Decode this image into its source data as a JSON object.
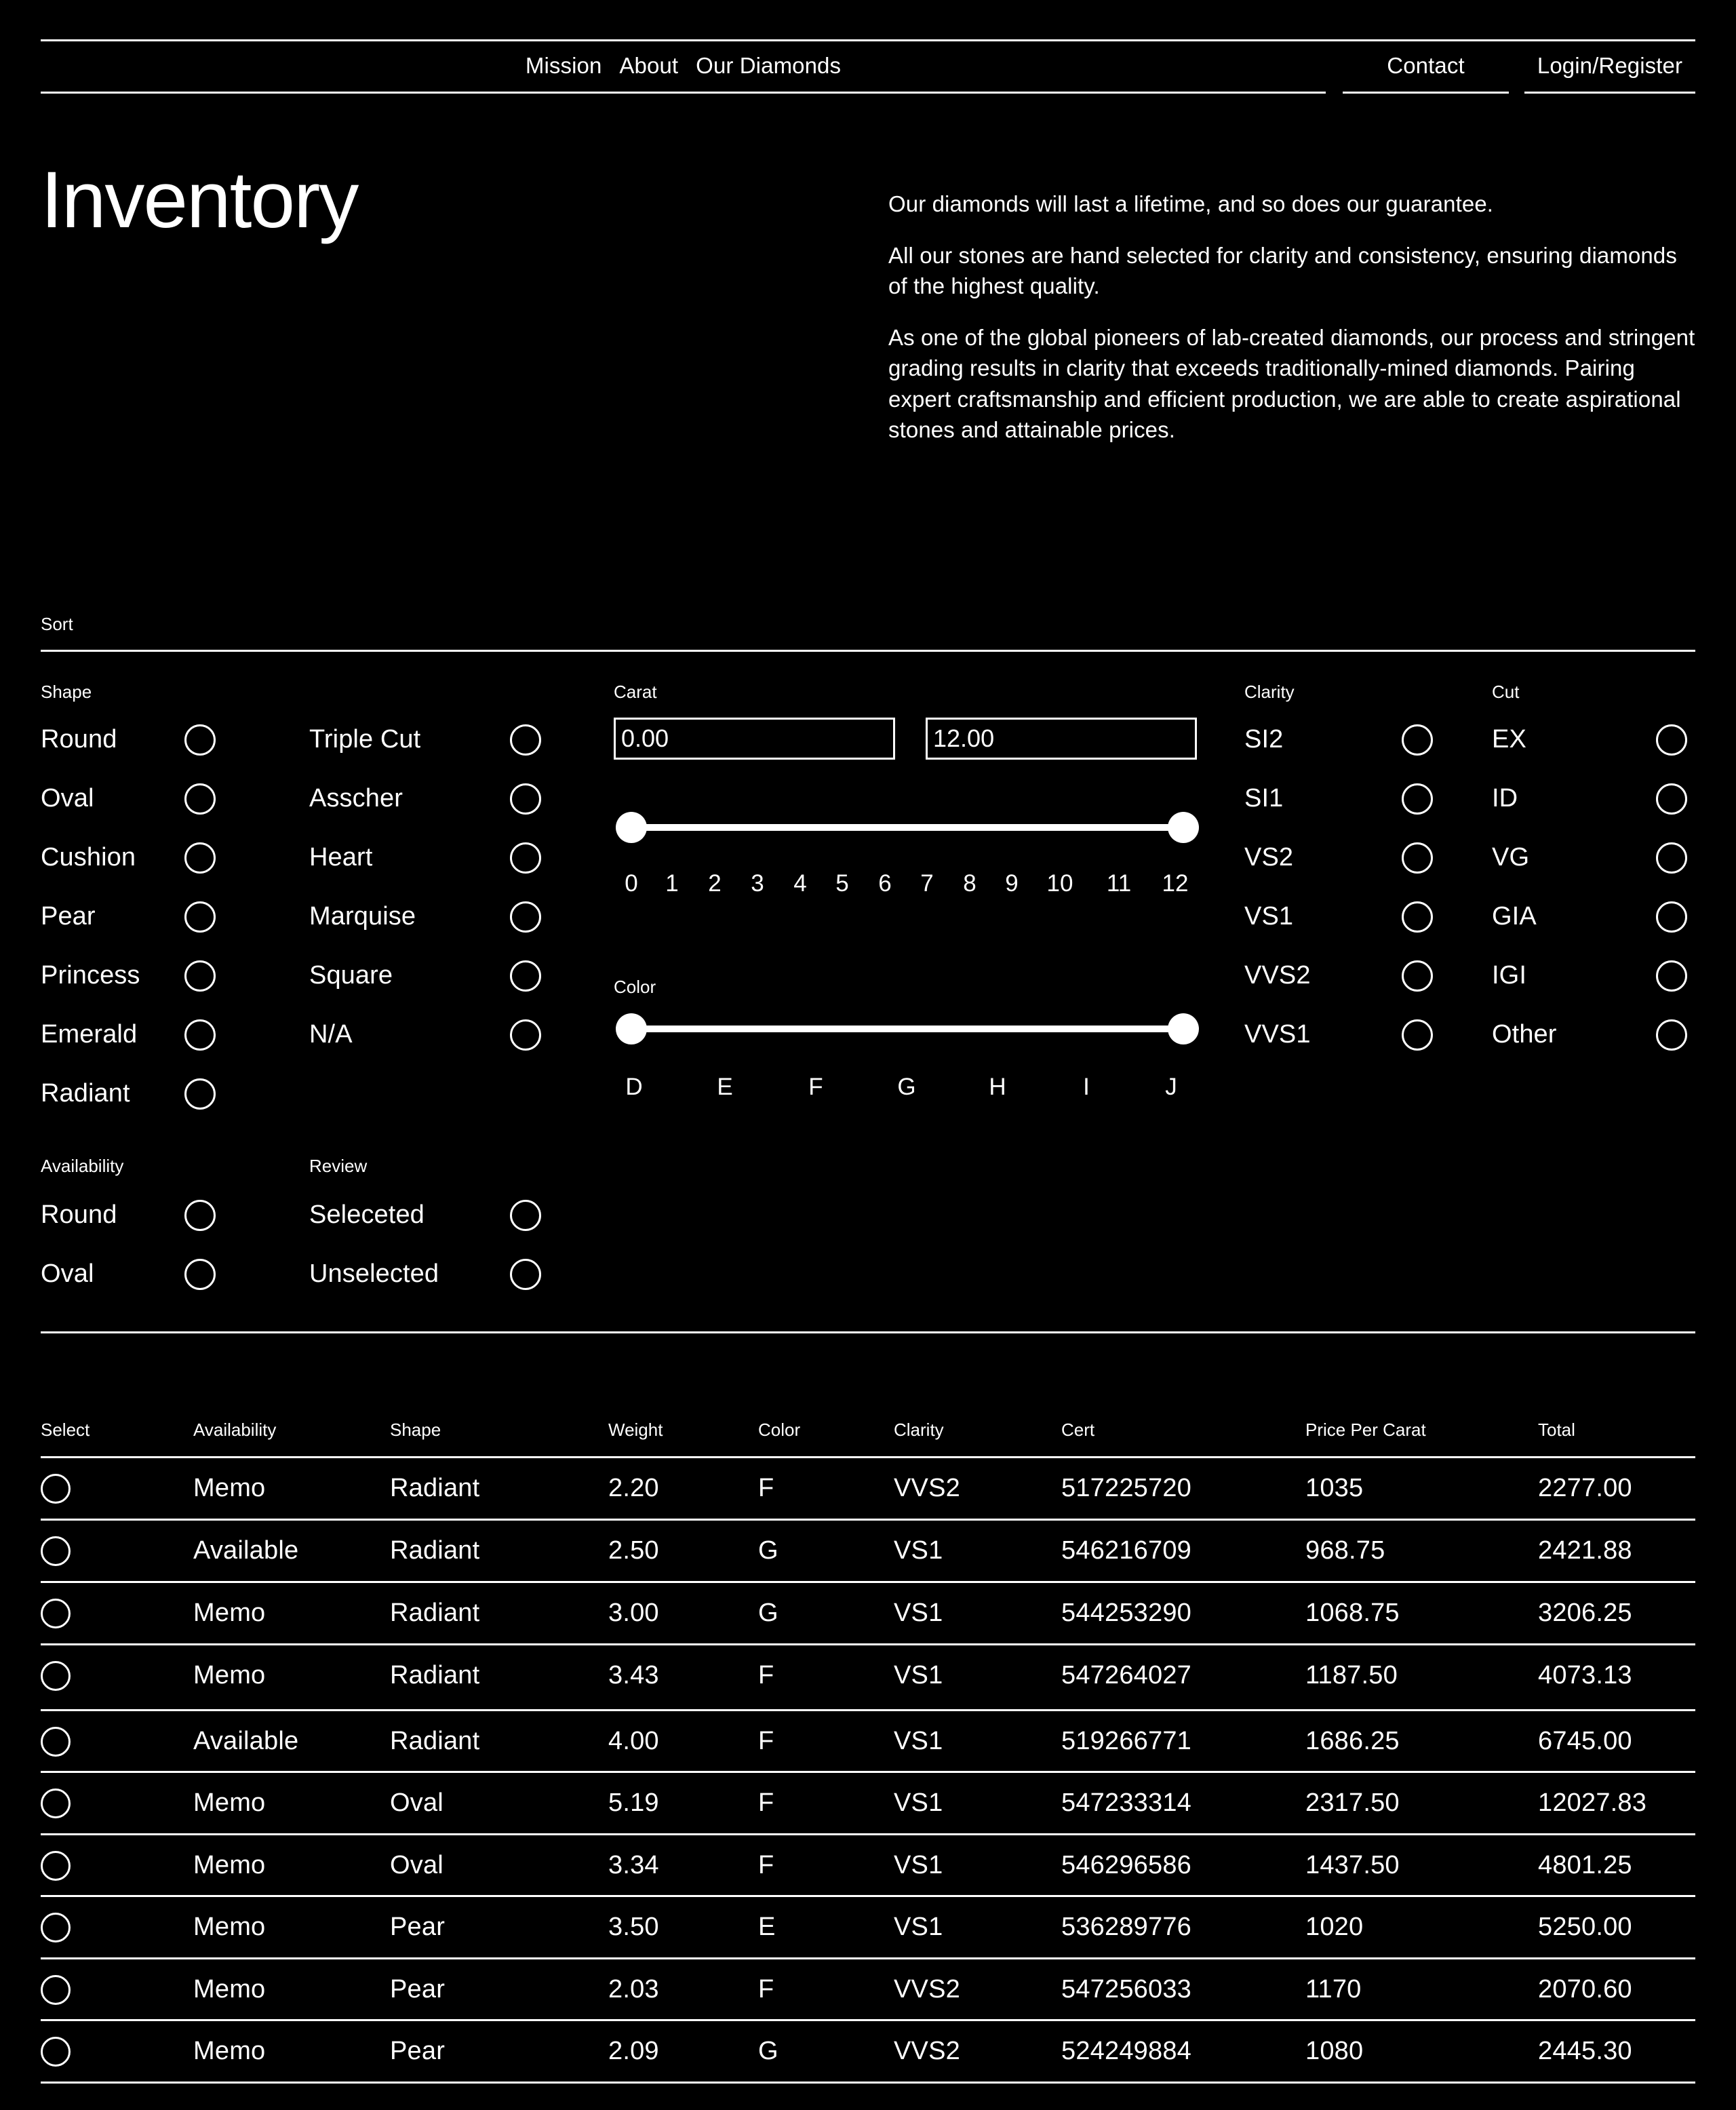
{
  "nav": {
    "primary": [
      "Mission",
      "About",
      "Our Diamonds"
    ],
    "contact": "Contact",
    "login": "Login/Register"
  },
  "hero": {
    "title": "Inventory",
    "paragraphs": [
      "Our diamonds will last a lifetime, and so does our guarantee.",
      "All our stones are hand selected for clarity and consistency, ensuring diamonds of the highest quality.",
      "As one of the global pioneers of lab-created diamonds, our process and stringent grading results in clarity that exceeds traditionally-mined diamonds. Pairing expert craftsmanship and efficient production, we are able to create aspirational stones and attainable prices."
    ]
  },
  "filters": {
    "sort_label": "Sort",
    "shape": {
      "title": "Shape",
      "column_one": [
        "Round",
        "Oval",
        "Cushion",
        "Pear",
        "Princess",
        "Emerald",
        "Radiant"
      ],
      "column_two": [
        "Triple Cut",
        "Asscher",
        "Heart",
        "Marquise",
        "Square",
        "N/A"
      ]
    },
    "carat": {
      "title": "Carat",
      "min_value": "0.00",
      "max_value": "12.00",
      "min_placeholder": "0.00",
      "max_placeholder": "12.00",
      "ticks": [
        "0",
        "1",
        "2",
        "3",
        "4",
        "5",
        "6",
        "7",
        "8",
        "9",
        "10",
        "11",
        "12"
      ]
    },
    "color": {
      "title": "Color",
      "ticks": [
        "D",
        "E",
        "F",
        "G",
        "H",
        "I",
        "J"
      ]
    },
    "clarity": {
      "title": "Clarity",
      "options": [
        "SI2",
        "SI1",
        "VS2",
        "VS1",
        "VVS2",
        "VVS1"
      ]
    },
    "cut": {
      "title": "Cut",
      "options": [
        "EX",
        "ID",
        "VG",
        "GIA",
        "IGI",
        "Other"
      ]
    },
    "availability": {
      "title": "Availability",
      "options": [
        "Round",
        "Oval"
      ]
    },
    "review": {
      "title": "Review",
      "options": [
        "Seleceted",
        "Unselected"
      ]
    }
  },
  "table": {
    "columns": [
      "Select",
      "Availability",
      "Shape",
      "Weight",
      "Color",
      "Clarity",
      "Cert",
      "Price Per Carat",
      "Total"
    ],
    "rows": [
      {
        "availability": "Memo",
        "shape": "Radiant",
        "weight": "2.20",
        "color": "F",
        "clarity": "VVS2",
        "cert": "517225720",
        "price_per_carat": "1035",
        "total": "2277.00"
      },
      {
        "availability": "Available",
        "shape": "Radiant",
        "weight": "2.50",
        "color": "G",
        "clarity": "VS1",
        "cert": "546216709",
        "price_per_carat": "968.75",
        "total": "2421.88"
      },
      {
        "availability": "Memo",
        "shape": "Radiant",
        "weight": "3.00",
        "color": "G",
        "clarity": "VS1",
        "cert": "544253290",
        "price_per_carat": "1068.75",
        "total": "3206.25"
      },
      {
        "availability": "Memo",
        "shape": "Radiant",
        "weight": "3.43",
        "color": "F",
        "clarity": "VS1",
        "cert": "547264027",
        "price_per_carat": "1187.50",
        "total": "4073.13"
      },
      {
        "availability": "Available",
        "shape": "Radiant",
        "weight": "4.00",
        "color": "F",
        "clarity": "VS1",
        "cert": "519266771",
        "price_per_carat": "1686.25",
        "total": "6745.00"
      },
      {
        "availability": "Memo",
        "shape": "Oval",
        "weight": "5.19",
        "color": "F",
        "clarity": "VS1",
        "cert": "547233314",
        "price_per_carat": "2317.50",
        "total": "12027.83"
      },
      {
        "availability": "Memo",
        "shape": "Oval",
        "weight": "3.34",
        "color": "F",
        "clarity": "VS1",
        "cert": "546296586",
        "price_per_carat": "1437.50",
        "total": "4801.25"
      },
      {
        "availability": "Memo",
        "shape": "Pear",
        "weight": "3.50",
        "color": "E",
        "clarity": "VS1",
        "cert": "536289776",
        "price_per_carat": "1020",
        "total": "5250.00"
      },
      {
        "availability": "Memo",
        "shape": "Pear",
        "weight": "2.03",
        "color": "F",
        "clarity": "VVS2",
        "cert": "547256033",
        "price_per_carat": "1170",
        "total": "2070.60"
      },
      {
        "availability": "Memo",
        "shape": "Pear",
        "weight": "2.09",
        "color": "G",
        "clarity": "VVS2",
        "cert": "524249884",
        "price_per_carat": "1080",
        "total": "2445.30"
      }
    ]
  },
  "colors": {
    "background": "#000000",
    "foreground": "#ffffff"
  }
}
